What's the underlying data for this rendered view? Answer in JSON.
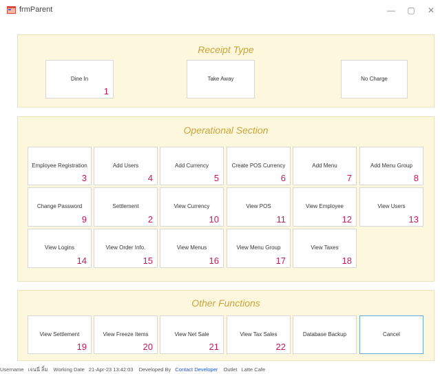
{
  "window": {
    "title": "frmParent",
    "minimize": "—",
    "maximize": "▢",
    "close": "✕",
    "icon": "window-app-icon",
    "icon_color": "#d94a3b"
  },
  "colors": {
    "panel_bg": "#fdf8dd",
    "section_title": "#c9a33a",
    "number": "#c2185b",
    "cancel_border": "#6aa9d8"
  },
  "receipt": {
    "title": "Receipt Type",
    "buttons": [
      {
        "label": "Dine In",
        "num": "1"
      },
      {
        "label": "Take Away",
        "num": ""
      },
      {
        "label": "No Charge",
        "num": ""
      }
    ]
  },
  "operational": {
    "title": "Operational Section",
    "buttons": [
      {
        "label": "Employee Registration",
        "num": "3"
      },
      {
        "label": "Add Users",
        "num": "4"
      },
      {
        "label": "Add Currency",
        "num": "5"
      },
      {
        "label": "Create POS Currency",
        "num": "6"
      },
      {
        "label": "Add Menu",
        "num": "7"
      },
      {
        "label": "Add Menu Group",
        "num": "8"
      },
      {
        "label": "Change Password",
        "num": "9"
      },
      {
        "label": "Settlement",
        "num": "2"
      },
      {
        "label": "View Currency",
        "num": "10"
      },
      {
        "label": "View POS",
        "num": "11"
      },
      {
        "label": "View Employee",
        "num": "12"
      },
      {
        "label": "View Users",
        "num": "13"
      },
      {
        "label": "View Logins",
        "num": "14"
      },
      {
        "label": "View Order Info.",
        "num": "15"
      },
      {
        "label": "View Menus",
        "num": "16"
      },
      {
        "label": "View Menu Group",
        "num": "17"
      },
      {
        "label": "View Taxes",
        "num": "18"
      }
    ]
  },
  "other": {
    "title": "Other Functions",
    "buttons": [
      {
        "label": "View Settlement",
        "num": "19"
      },
      {
        "label": "View Freeze Items",
        "num": "20"
      },
      {
        "label": "View Net Sale",
        "num": "21"
      },
      {
        "label": "View Tax Sales",
        "num": "22"
      },
      {
        "label": "Database Backup",
        "num": ""
      },
      {
        "label": "Cancel",
        "num": ""
      }
    ]
  },
  "status": {
    "username_label": "Username",
    "username": "เจนนี่ ลิ้ม",
    "working_date_label": "Working Date",
    "working_date": "21-Apr-23 13:42:03",
    "developed_by_label": "Developed By",
    "contact_link": "Contact Developer",
    "outlet_label": "Outlet",
    "outlet": "Latte Cafe"
  }
}
